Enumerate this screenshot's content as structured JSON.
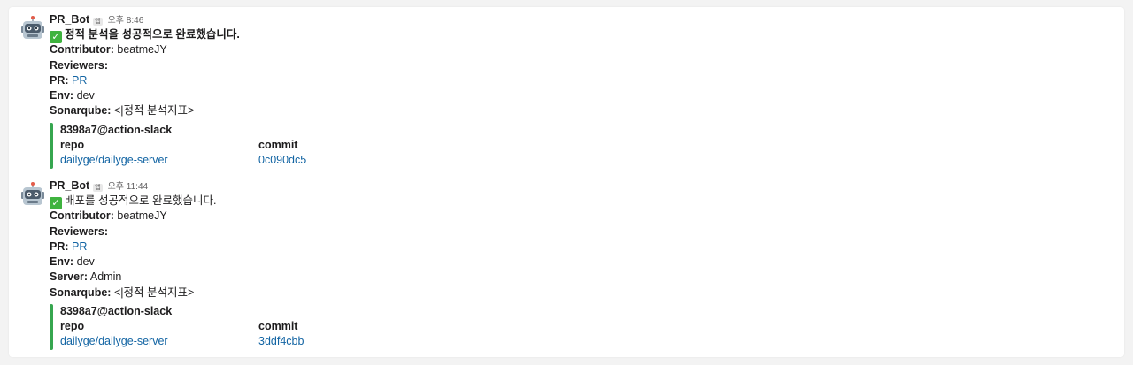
{
  "messages": [
    {
      "sender": "PR_Bot",
      "badge": "앱",
      "time": "오후 8:46",
      "status_text": "정적 분석을 성공적으로 완료했습니다.",
      "status_bold": true,
      "lines": [
        {
          "label": "Contributor:",
          "value": "beatmeJY",
          "link": false
        },
        {
          "label": "Reviewers:",
          "value": "",
          "link": false
        },
        {
          "label": "PR:",
          "value": "PR",
          "link": true
        },
        {
          "label": "Env:",
          "value": "dev",
          "link": false
        },
        {
          "label": "Sonarqube:",
          "value": "<|정적 분석지표>",
          "link": false
        }
      ],
      "attachment": {
        "title": "8398a7@action-slack",
        "fields": [
          {
            "title": "repo",
            "value": "dailyge/dailyge-server"
          },
          {
            "title": "commit",
            "value": "0c090dc5"
          }
        ]
      }
    },
    {
      "sender": "PR_Bot",
      "badge": "앱",
      "time": "오후 11:44",
      "status_text": "배포를 성공적으로 완료했습니다.",
      "status_bold": false,
      "lines": [
        {
          "label": "Contributor:",
          "value": "beatmeJY",
          "link": false
        },
        {
          "label": "Reviewers:",
          "value": "",
          "link": false
        },
        {
          "label": "PR:",
          "value": "PR",
          "link": true
        },
        {
          "label": "Env:",
          "value": "dev",
          "link": false
        },
        {
          "label": "Server:",
          "value": "Admin",
          "link": false
        },
        {
          "label": "Sonarqube:",
          "value": "<|정적 분석지표>",
          "link": false
        }
      ],
      "attachment": {
        "title": "8398a7@action-slack",
        "fields": [
          {
            "title": "repo",
            "value": "dailyge/dailyge-server"
          },
          {
            "title": "commit",
            "value": "3ddf4cbb"
          }
        ]
      }
    }
  ],
  "colors": {
    "attachment_bar": "#36a64f",
    "link": "#1264a3",
    "check": "#3fb33f"
  },
  "icons": {
    "avatar": "robot-face-icon",
    "status": "white-check-mark-icon"
  }
}
